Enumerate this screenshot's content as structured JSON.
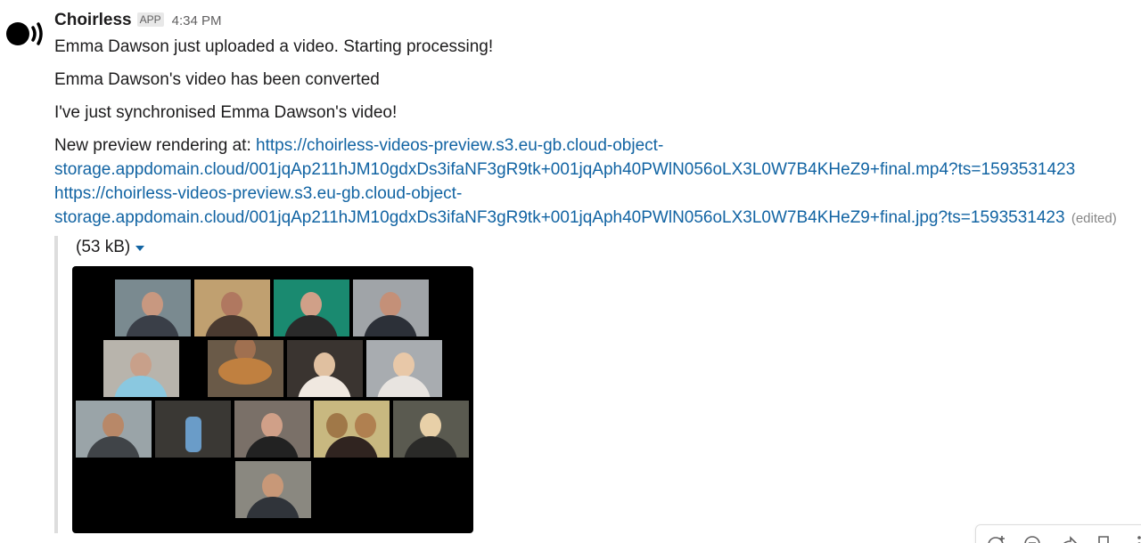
{
  "message": {
    "sender": "Choirless",
    "badge": "APP",
    "timestamp": "4:34 PM",
    "lines": [
      "Emma Dawson just uploaded a video. Starting processing!",
      "Emma Dawson's video has been converted",
      "I've just synchronised Emma Dawson's video!"
    ],
    "preview": {
      "prefix": "New preview rendering at:",
      "link1_part1": "https://choirless-videos-preview.s3.eu-gb.cloud-object-",
      "link1_part2": "storage.appdomain.cloud/001jqAp211hJM10gdxDs3ifaNF3gR9tk+001jqAph40PWlN056oLX3L0W7B4KHeZ9+final.mp4?ts=1593531423",
      "link2_part1": "https://choirless-videos-preview.s3.eu-gb.cloud-object-",
      "link2_part2": "storage.appdomain.cloud/001jqAp211hJM10gdxDs3ifaNF3gR9tk+001jqAph40PWlN056oLX3L0W7B4KHeZ9+final.jpg?ts=1593531423",
      "edited": "(edited)"
    }
  },
  "attachment": {
    "size": "(53 kB)",
    "image_icon": "video-grid-thumbnail",
    "tile_count": 14
  },
  "toolbar": {
    "icons": [
      "add-reaction-icon",
      "reply-thread-icon",
      "share-icon",
      "save-icon",
      "more-actions-icon"
    ]
  },
  "colors": {
    "link": "#1264a3",
    "text": "#1d1c1d",
    "muted": "#616061",
    "border": "#dddddd"
  }
}
